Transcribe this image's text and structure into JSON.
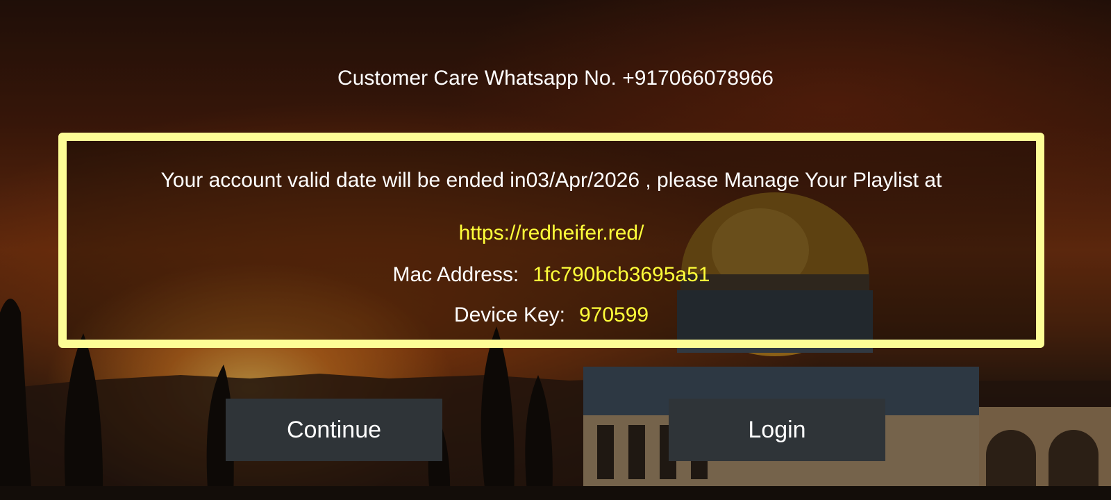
{
  "header": {
    "customer_care": "Customer Care Whatsapp No. +917066078966"
  },
  "account": {
    "validity_message": "Your account valid date will be ended in03/Apr/2026 , please Manage Your Playlist at",
    "playlist_url": "https://redheifer.red/",
    "mac_label": "Mac Address:",
    "mac_value": "1fc790bcb3695a51",
    "device_key_label": "Device Key:",
    "device_key_value": "970599"
  },
  "buttons": {
    "continue_label": "Continue",
    "login_label": "Login"
  },
  "colors": {
    "panel_border": "#fdfd96",
    "highlight_text": "#ffff3a",
    "button_bg": "#2f3438"
  }
}
